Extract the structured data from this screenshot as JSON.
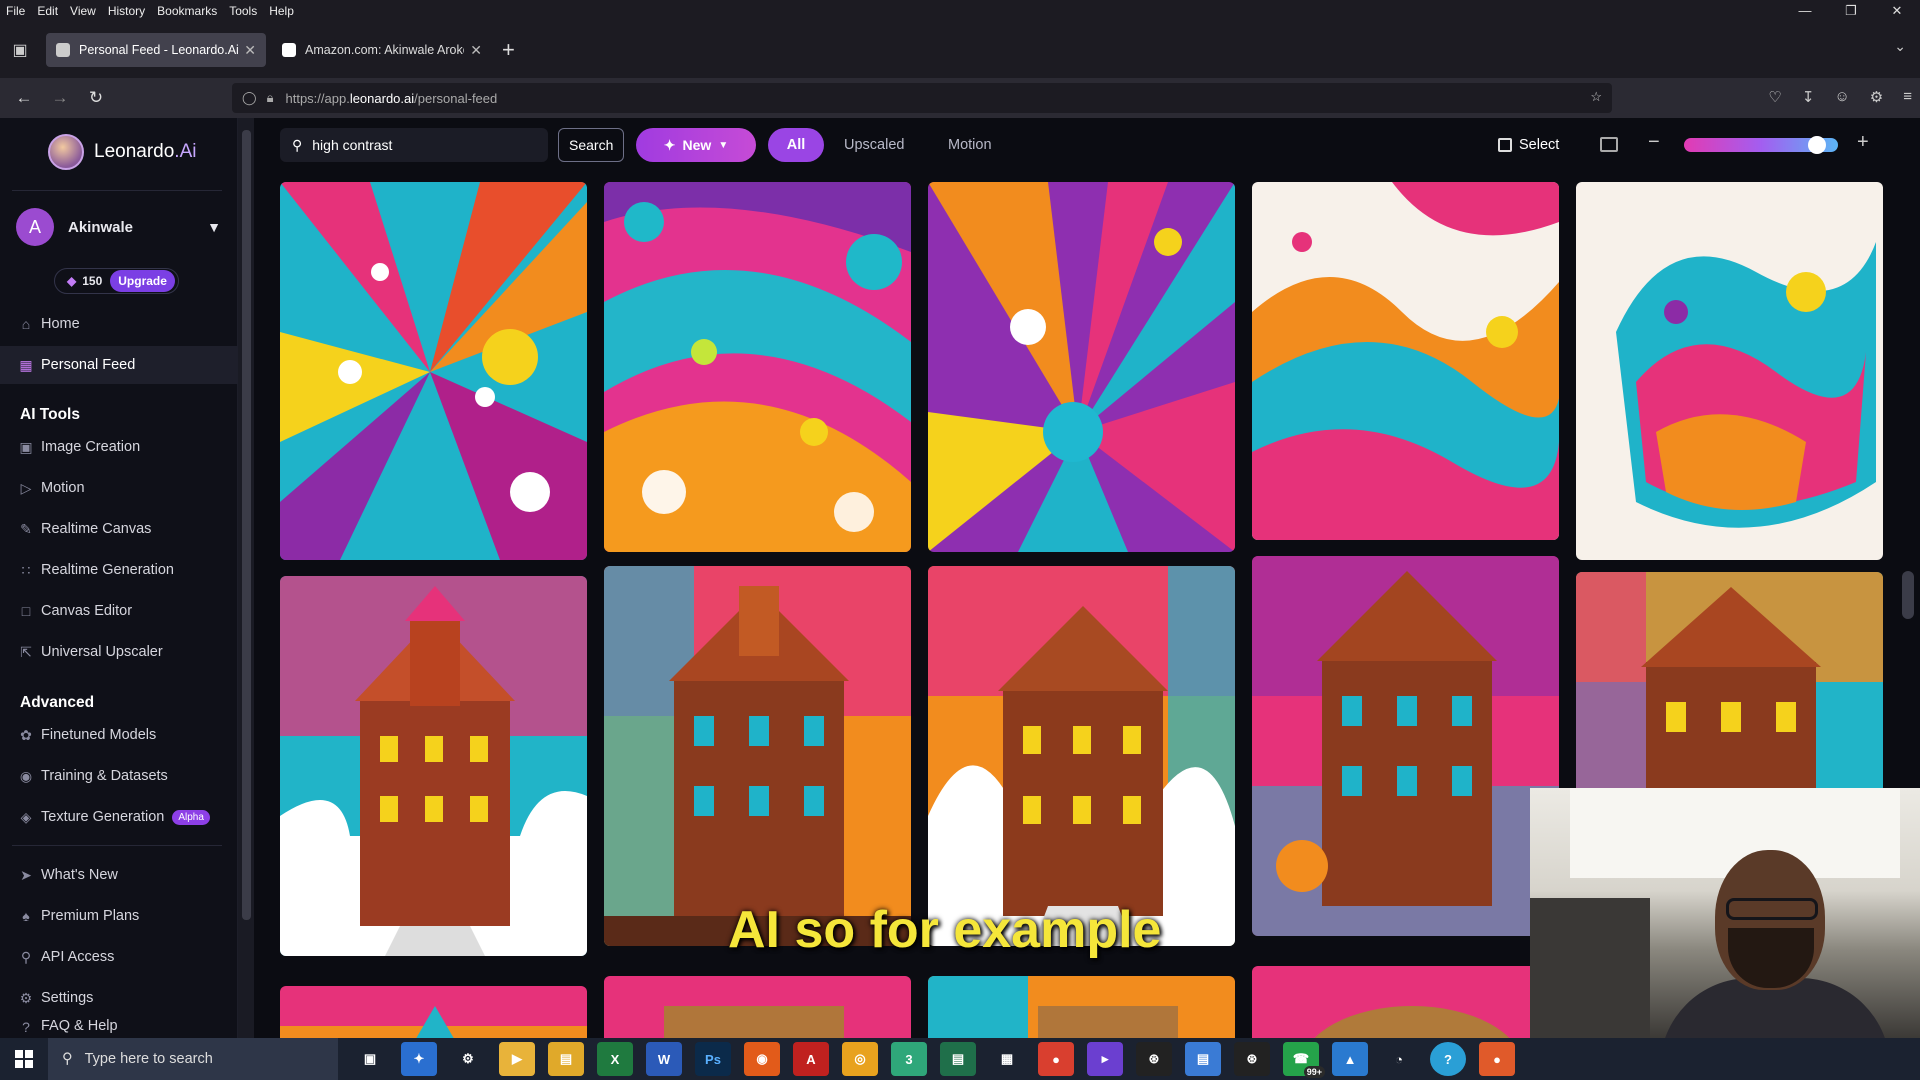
{
  "browser": {
    "menu": [
      "File",
      "Edit",
      "View",
      "History",
      "Bookmarks",
      "Tools",
      "Help"
    ],
    "tabs": [
      {
        "title": "Personal Feed - Leonardo.Ai",
        "active": true
      },
      {
        "title": "Amazon.com: Akinwale Arokoo",
        "active": false
      }
    ],
    "url_prefix": "https://app.",
    "url_domain": "leonardo.ai",
    "url_path": "/personal-feed"
  },
  "sidebar": {
    "brand": "Leonardo",
    "brand_suffix": ".Ai",
    "user": {
      "initial": "A",
      "name": "Akinwale"
    },
    "tokens": "150",
    "upgrade_label": "Upgrade",
    "nav": [
      {
        "label": "Home",
        "icon": "home-icon"
      },
      {
        "label": "Personal Feed",
        "icon": "grid-icon",
        "active": true
      }
    ],
    "ai_tools_heading": "AI Tools",
    "ai_tools": [
      {
        "label": "Image Creation",
        "icon": "image-icon"
      },
      {
        "label": "Motion",
        "icon": "motion-icon"
      },
      {
        "label": "Realtime Canvas",
        "icon": "brush-icon"
      },
      {
        "label": "Realtime Generation",
        "icon": "sparkle-grid-icon"
      },
      {
        "label": "Canvas Editor",
        "icon": "canvas-icon"
      },
      {
        "label": "Universal Upscaler",
        "icon": "upscale-icon"
      }
    ],
    "advanced_heading": "Advanced",
    "advanced": [
      {
        "label": "Finetuned Models",
        "icon": "models-icon"
      },
      {
        "label": "Training & Datasets",
        "icon": "training-icon"
      },
      {
        "label": "Texture Generation",
        "icon": "texture-icon",
        "badge": "Alpha"
      }
    ],
    "footer": [
      {
        "label": "What's New",
        "icon": "megaphone-icon"
      },
      {
        "label": "Premium Plans",
        "icon": "plans-icon"
      },
      {
        "label": "API Access",
        "icon": "key-icon"
      },
      {
        "label": "Settings",
        "icon": "gear-icon"
      },
      {
        "label": "FAQ & Help",
        "icon": "help-icon"
      }
    ]
  },
  "toolbar": {
    "search_value": "high contrast",
    "search_button": "Search",
    "new_button": "New",
    "filters": [
      "All",
      "Upscaled",
      "Motion"
    ],
    "select_label": "Select",
    "zoom_level": 0.85
  },
  "subtitle": "AI so for example",
  "taskbar": {
    "search_placeholder": "Type here to search",
    "notification_badge": "99+"
  },
  "colors": {
    "accent": "#9a45e4",
    "background": "#0b0c12",
    "sidebar": "#0f1018"
  }
}
